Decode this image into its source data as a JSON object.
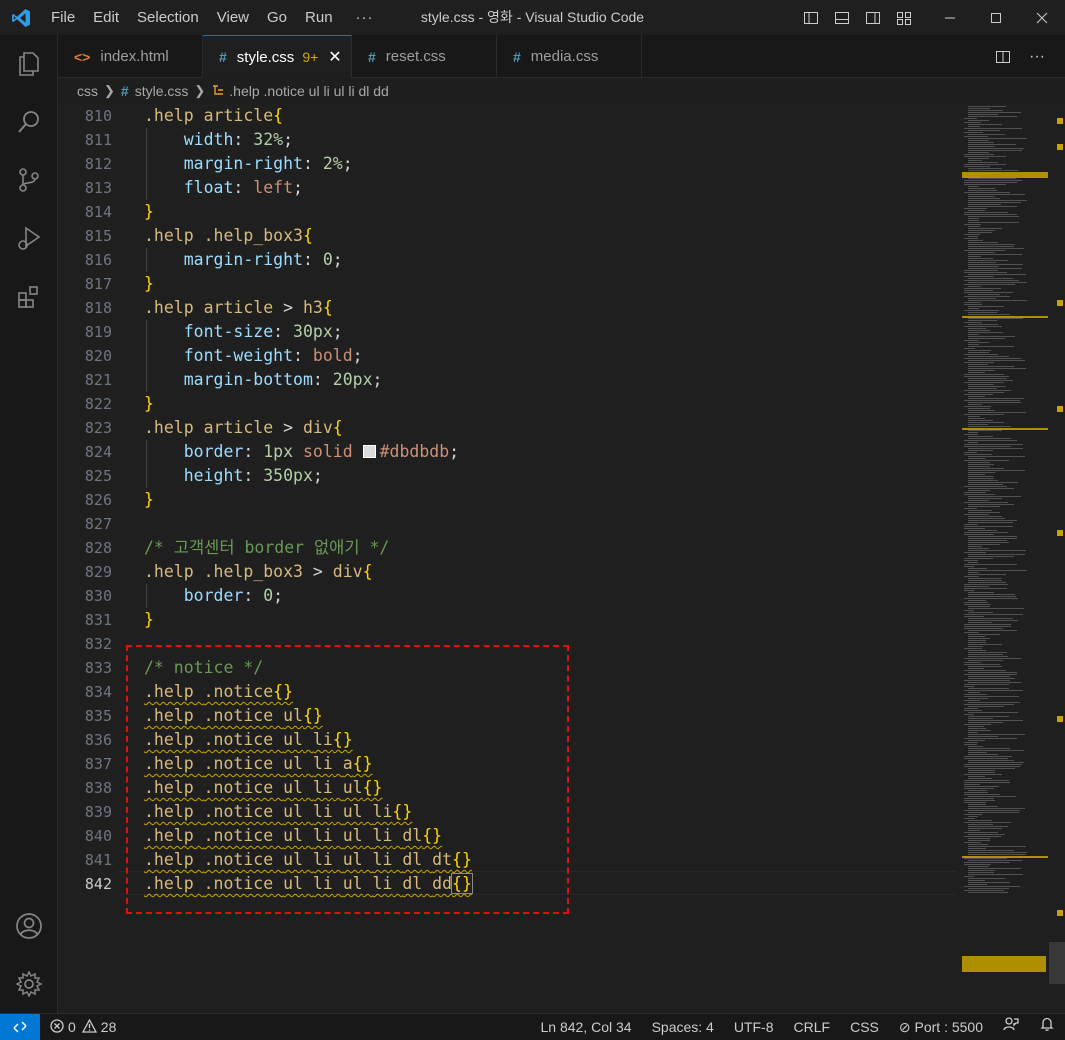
{
  "titlebar": {
    "menus": [
      "File",
      "Edit",
      "Selection",
      "View",
      "Go",
      "Run"
    ],
    "more": "···",
    "title": "style.css - 영화 - Visual Studio Code"
  },
  "tabs": [
    {
      "label": "index.html",
      "icon": "html-file-icon",
      "active": false
    },
    {
      "label": "style.css",
      "icon": "css-file-icon",
      "active": true,
      "badge": "9+"
    },
    {
      "label": "reset.css",
      "icon": "css-file-icon",
      "active": false
    },
    {
      "label": "media.css",
      "icon": "css-file-icon",
      "active": false
    }
  ],
  "breadcrumb": {
    "folder": "css",
    "file": "style.css",
    "symbol": ".help .notice ul li ul li dl dd"
  },
  "editor": {
    "first_line": 810,
    "current_line": 842,
    "lines": [
      ".help article{",
      "    width: 32%;",
      "    margin-right: 2%;",
      "    float: left;",
      "}",
      ".help .help_box3{",
      "    margin-right: 0;",
      "}",
      ".help article > h3{",
      "    font-size: 30px;",
      "    font-weight: bold;",
      "    margin-bottom: 20px;",
      "}",
      ".help article > div{",
      "    border: 1px solid #dbdbdb;",
      "    height: 350px;",
      "}",
      "",
      "/* 고객센터 border 없애기 */",
      ".help .help_box3 > div{",
      "    border: 0;",
      "}",
      "",
      "/* notice */",
      ".help .notice{}",
      ".help .notice ul{}",
      ".help .notice ul li{}",
      ".help .notice ul li a{}",
      ".help .notice ul li ul{}",
      ".help .notice ul li ul li{}",
      ".help .notice ul li ul li dl{}",
      ".help .notice ul li ul li dl dt{}",
      ".help .notice ul li ul li dl dd{}"
    ]
  },
  "statusbar": {
    "errors": "0",
    "warnings": "28",
    "position": "Ln 842, Col 34",
    "spaces": "Spaces: 4",
    "encoding": "UTF-8",
    "eol": "CRLF",
    "language": "CSS",
    "port": "Port : 5500"
  },
  "colors": {
    "accent": "#0078d4",
    "selector": "#d7ba7d",
    "property": "#9cdcfe",
    "number": "#b5cea8",
    "string": "#ce9178",
    "comment": "#6a9955",
    "brace": "#ffd700",
    "warning": "#cca700",
    "highlight_box": "#e01010"
  }
}
